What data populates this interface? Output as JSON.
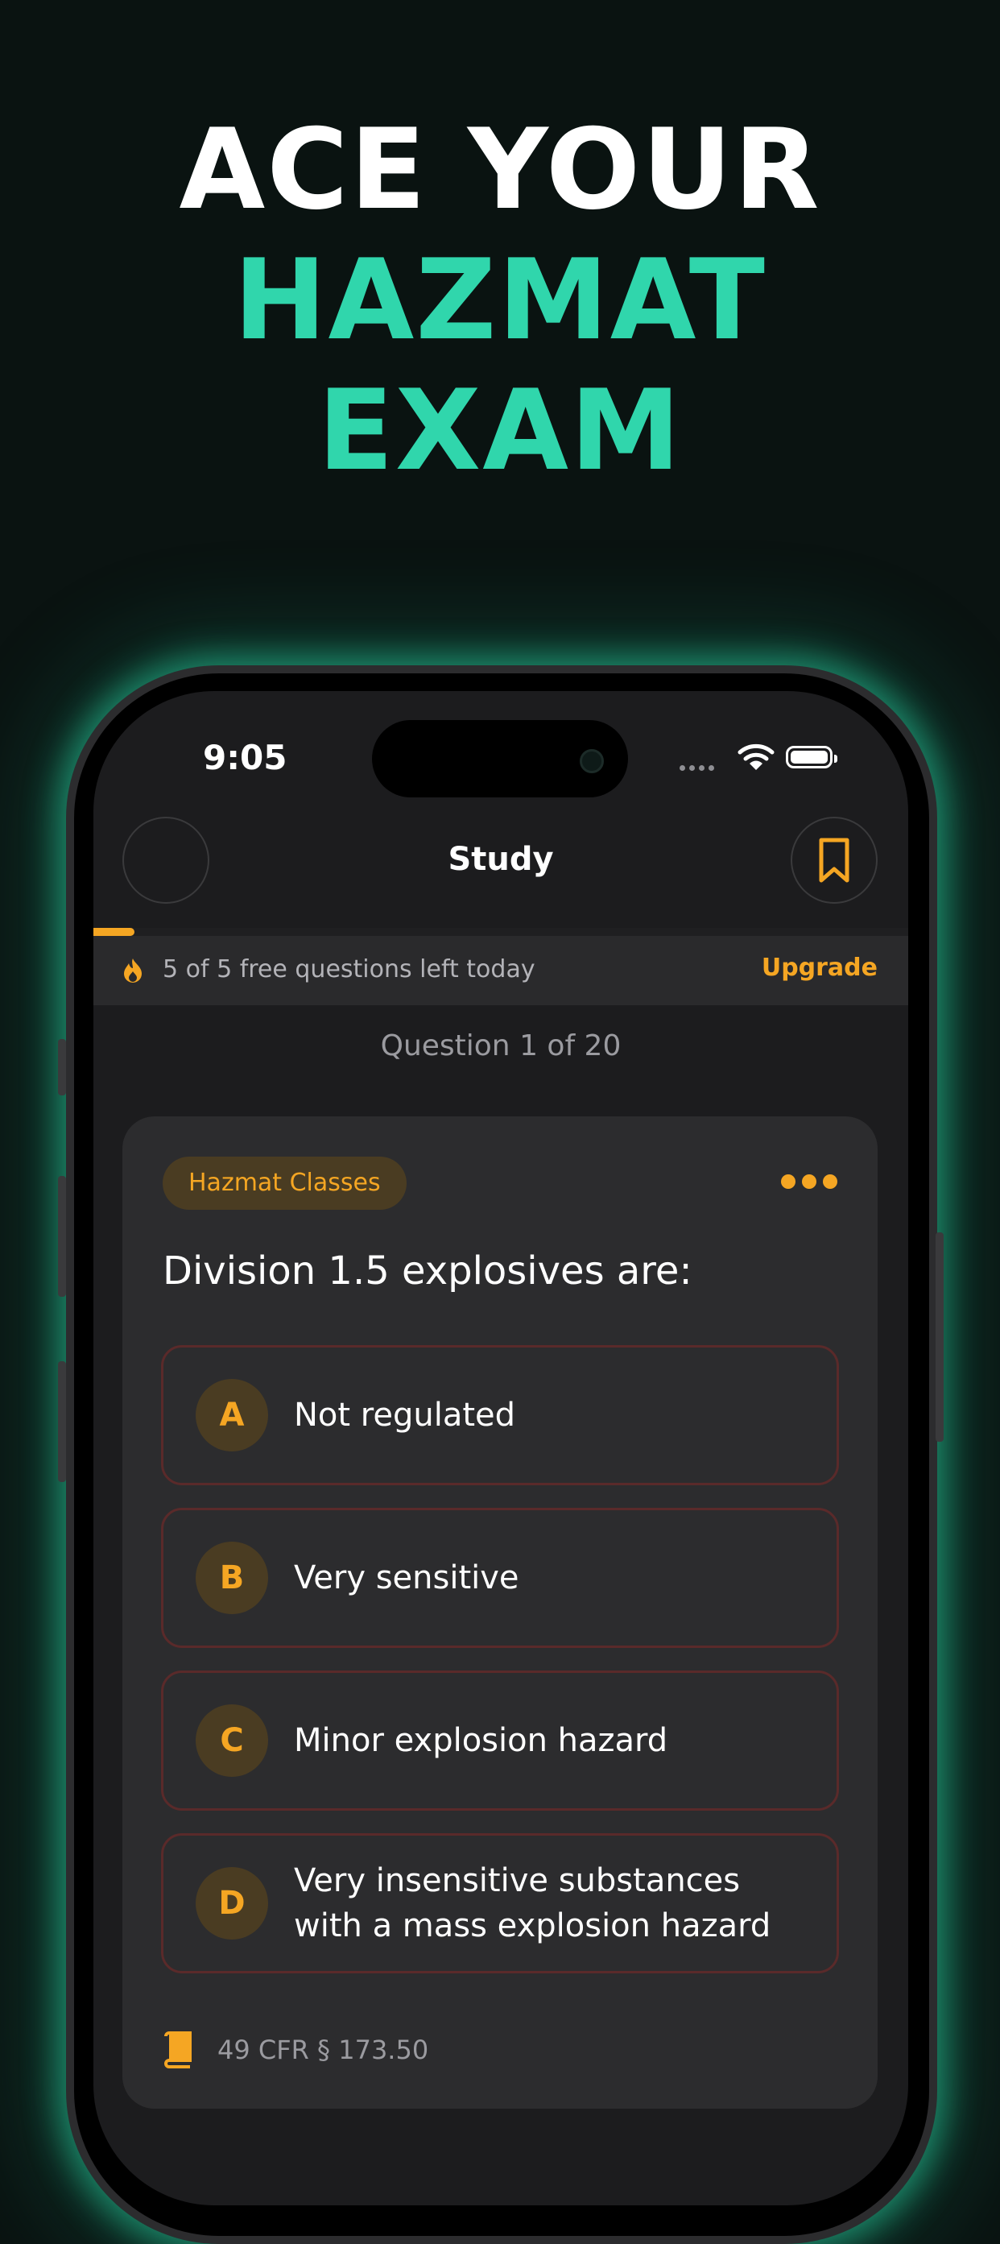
{
  "headline": {
    "line1": "ACE YOUR",
    "line2": "HAZMAT",
    "line3": "EXAM"
  },
  "colors": {
    "accent": "#30d6ac",
    "orange": "#f5a623",
    "background": "#0a1311"
  },
  "status_bar": {
    "time": "9:05"
  },
  "nav": {
    "title": "Study",
    "right_icon": "bookmark-icon"
  },
  "progress": {
    "fraction": 0.05
  },
  "banner": {
    "icon": "flame-icon",
    "text": "5 of 5 free questions left today",
    "action": "Upgrade"
  },
  "counter": "Question 1 of 20",
  "card": {
    "category": "Hazmat Classes",
    "question": "Division 1.5 explosives are:",
    "answers": [
      {
        "letter": "A",
        "text": "Not regulated"
      },
      {
        "letter": "B",
        "text": "Very sensitive"
      },
      {
        "letter": "C",
        "text": "Minor explosion hazard"
      },
      {
        "letter": "D",
        "text": "Very insensitive substances with a mass explosion hazard"
      }
    ],
    "reference": "49 CFR § 173.50",
    "reference_icon": "book-icon"
  }
}
